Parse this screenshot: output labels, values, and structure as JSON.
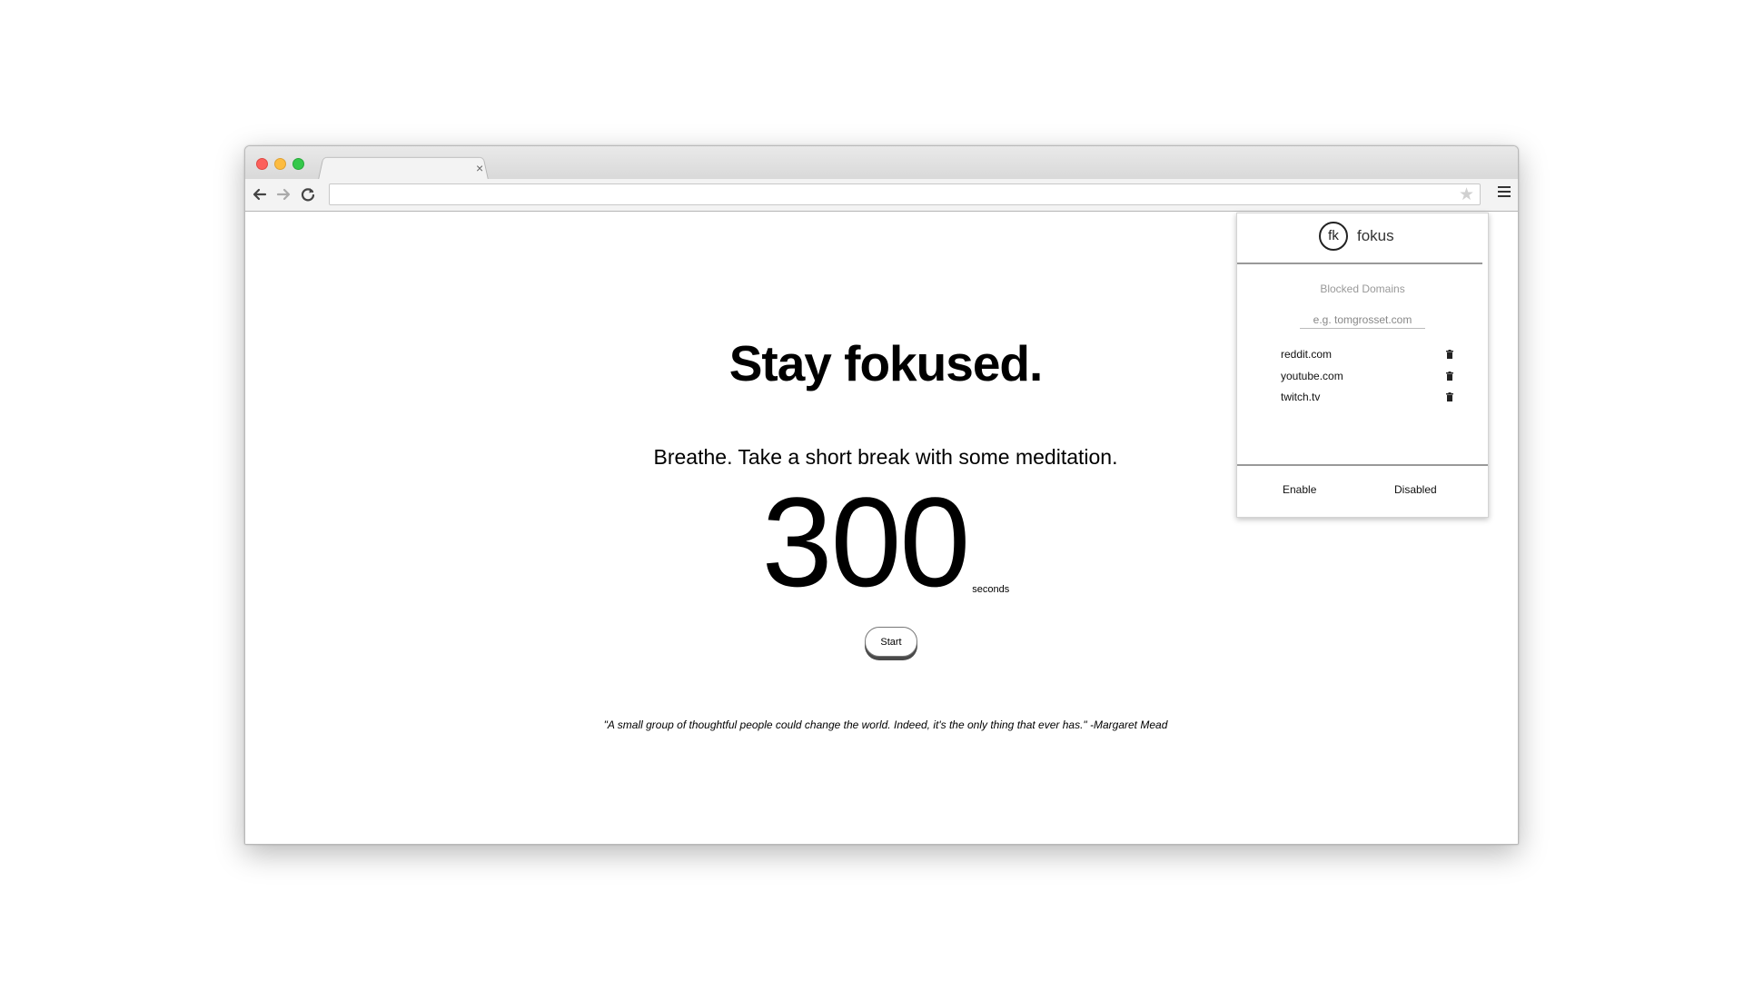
{
  "browser": {
    "tab": {
      "title": "",
      "close_glyph": "×"
    },
    "address_bar": {
      "value": ""
    },
    "icons": {
      "back": "back-arrow-icon",
      "forward": "forward-arrow-icon",
      "reload": "reload-icon",
      "bookmark": "star-icon",
      "menu": "hamburger-menu-icon"
    }
  },
  "page": {
    "headline": "Stay fokused.",
    "subline": "Breathe. Take a short break with some meditation.",
    "timer": {
      "value": "300",
      "unit": "seconds"
    },
    "start_label": "Start",
    "quote": "\"A small group of thoughtful people could change the world. Indeed, it's the only thing that ever has.\" -Margaret Mead"
  },
  "extension_popup": {
    "logo_mark": "fk",
    "brand_name": "fokus",
    "section_title": "Blocked Domains",
    "input": {
      "value": "",
      "placeholder": "e.g. tomgrosset.com"
    },
    "domains": [
      {
        "name": "reddit.com",
        "icon": "trash-icon"
      },
      {
        "name": "youtube.com",
        "icon": "trash-icon"
      },
      {
        "name": "twitch.tv",
        "icon": "trash-icon"
      }
    ],
    "enable_label": "Enable",
    "disabled_label": "Disabled"
  }
}
